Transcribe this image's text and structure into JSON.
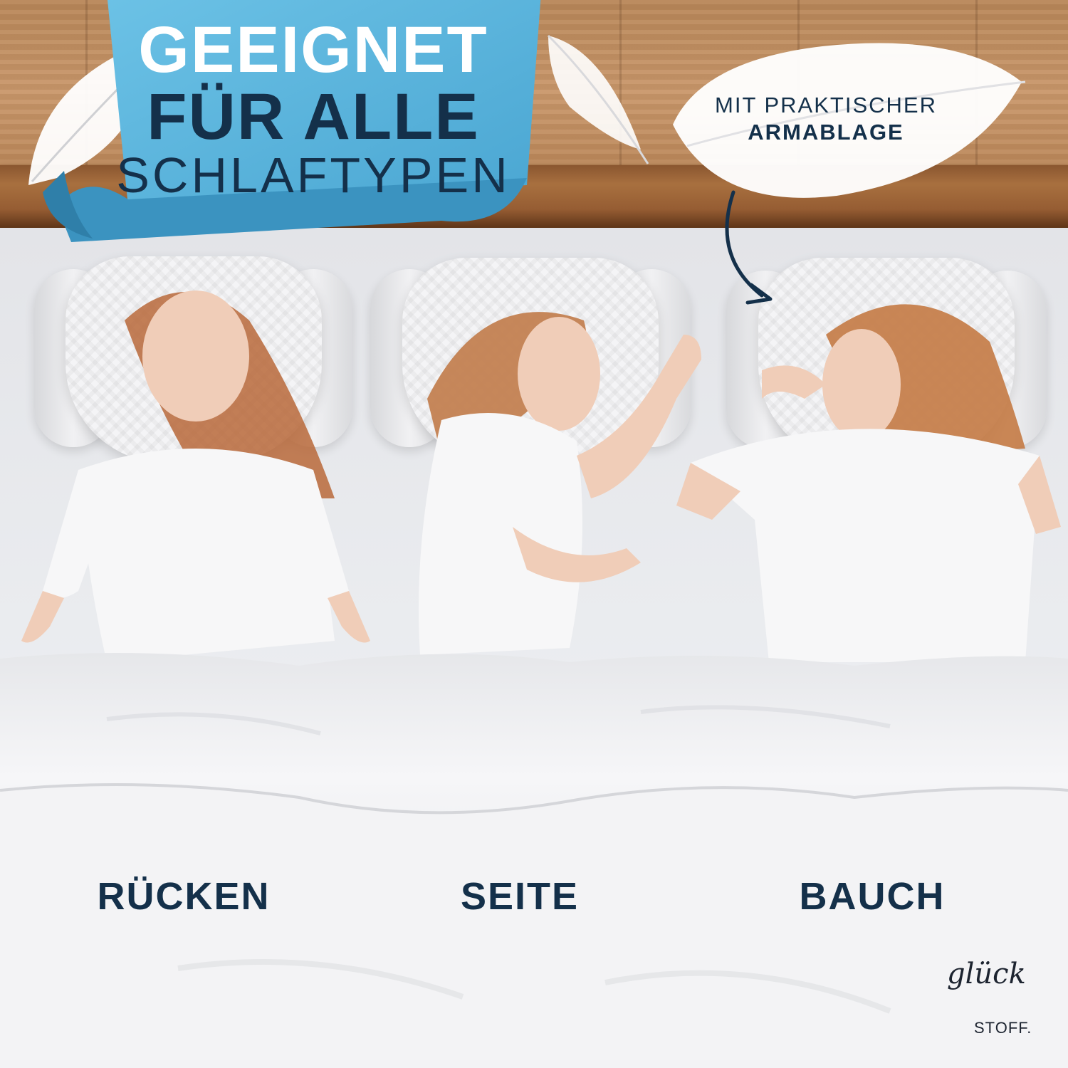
{
  "headline": {
    "line1": "GEEIGNET",
    "line2": "FÜR ALLE",
    "line3": "SCHLAFTYPEN"
  },
  "callout": {
    "line1": "MIT PRAKTISCHER",
    "line2": "ARMABLAGE"
  },
  "positions": [
    {
      "label": "RÜCKEN"
    },
    {
      "label": "SEITE"
    },
    {
      "label": "BAUCH"
    }
  ],
  "brand": {
    "script": "glück",
    "sub": "STOFF."
  },
  "colors": {
    "navy": "#14304a",
    "banner_blue": "#5fb6dc",
    "wood": "#b88658",
    "sheet": "#eceef1"
  }
}
